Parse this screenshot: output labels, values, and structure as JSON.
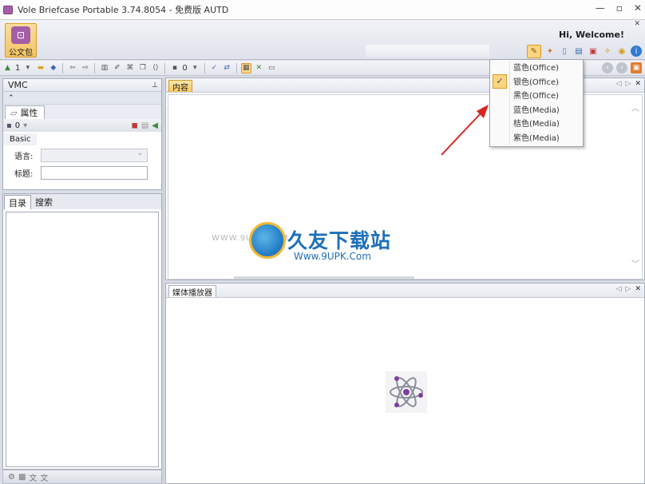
{
  "window": {
    "title": "Vole Briefcase Portable  3.74.8054 - 免费版 AUTD",
    "minimize": "—",
    "maximize": "▫",
    "close": "✕"
  },
  "ribbon": {
    "briefcase_label": "公文包",
    "welcome": "Hi, Welcome!",
    "collapse_glyph": "✕"
  },
  "toolbar": {
    "count_a": "1",
    "count_b": "0"
  },
  "left_panel": {
    "title": "VMC",
    "pin": "⊥",
    "collapse": "⌃",
    "prop_tab": "属性",
    "prop_count": "0",
    "basic_tab": "Basic",
    "lang_label": "语言:",
    "title_label": "标题:"
  },
  "nav_tabs": [
    "目录",
    "搜索"
  ],
  "content": {
    "tab": "内容",
    "media_tab": "媒体播放器"
  },
  "watermark": {
    "left": "WWW.9UPK.COM",
    "brand": "久友下载站",
    "url": "Www.9UPK.Com"
  },
  "theme_menu": {
    "items": [
      {
        "label": "蓝色(Office)",
        "checked": false
      },
      {
        "label": "银色(Office)",
        "checked": true
      },
      {
        "label": "黑色(Office)",
        "checked": false
      },
      {
        "label": "蓝色(Media)",
        "checked": false
      },
      {
        "label": "桔色(Media)",
        "checked": false
      },
      {
        "label": "紫色(Media)",
        "checked": false
      }
    ]
  },
  "colors": {
    "accent_orange": "#f7c85f",
    "brand_purple": "#a35ea7",
    "annotation_red": "#d9241b",
    "watermark_blue": "#1c6fba"
  }
}
